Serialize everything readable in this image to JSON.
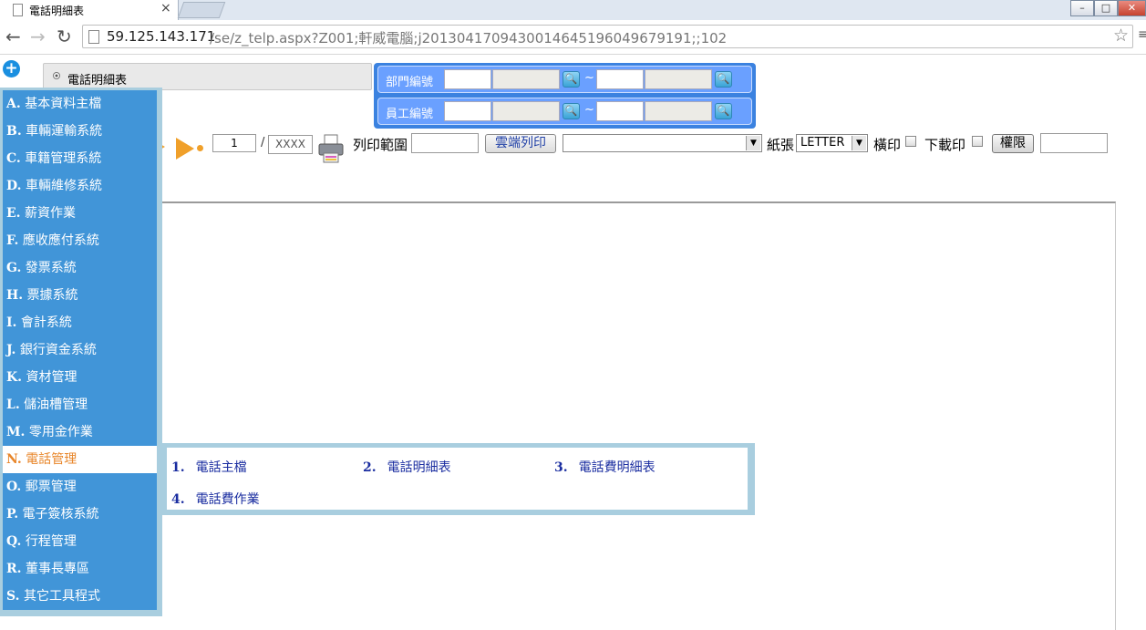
{
  "browser": {
    "tab_title": "電話明細表",
    "tab_close": "×",
    "win_min": "–",
    "win_max": "□",
    "win_close": "✕",
    "url_host": "59.125.143.171",
    "url_path": "/se/z_telp.aspx?Z001;軒威電腦;j20130417094300146451960496791​91;;102",
    "back": "←",
    "forward": "→",
    "reload": "↻",
    "star": "☆",
    "menu": "≡"
  },
  "page": {
    "plus": "+",
    "title": "電話明細表"
  },
  "filters": {
    "dept_label": "部門編號",
    "emp_label": "員工編號",
    "search_glyph": "🔍",
    "tilde": "~"
  },
  "toolbar": {
    "page_current": "1",
    "page_slash": "/",
    "page_total": "XXXX",
    "range_label": "列印範圍",
    "cloud_print": "雲端列印",
    "dropdown_glyph": "▼",
    "paper_label": "紙張",
    "paper_value": "LETTER",
    "landscape_label": "橫印",
    "download_label": "下載印",
    "permission": "權限"
  },
  "menu": {
    "items": [
      {
        "key": "A.",
        "label": "基本資料主檔"
      },
      {
        "key": "B.",
        "label": "車輛運輸系統"
      },
      {
        "key": "C.",
        "label": "車籍管理系統"
      },
      {
        "key": "D.",
        "label": "車輛維修系統"
      },
      {
        "key": "E.",
        "label": "薪資作業"
      },
      {
        "key": "F.",
        "label": "應收應付系統"
      },
      {
        "key": "G.",
        "label": "發票系統"
      },
      {
        "key": "H.",
        "label": "票據系統"
      },
      {
        "key": "I.",
        "label": "會計系統"
      },
      {
        "key": "J.",
        "label": "銀行資金系統"
      },
      {
        "key": "K.",
        "label": "資材管理"
      },
      {
        "key": "L.",
        "label": "儲油槽管理"
      },
      {
        "key": "M.",
        "label": "零用金作業"
      },
      {
        "key": "N.",
        "label": "電話管理"
      },
      {
        "key": "O.",
        "label": "郵票管理"
      },
      {
        "key": "P.",
        "label": "電子簽核系統"
      },
      {
        "key": "Q.",
        "label": "行程管理"
      },
      {
        "key": "R.",
        "label": "董事長專區"
      },
      {
        "key": "S.",
        "label": "其它工具程式"
      }
    ],
    "active_index": 13
  },
  "submenu": {
    "items": [
      {
        "num": "1.",
        "label": "電話主檔"
      },
      {
        "num": "2.",
        "label": "電話明細表"
      },
      {
        "num": "3.",
        "label": "電話費明細表"
      },
      {
        "num": "4.",
        "label": "電話費作業"
      }
    ]
  },
  "colors": {
    "menu_bg": "#4195d8",
    "menu_active_text": "#e8862a",
    "filter_bg": "#3b82e0",
    "arrow": "#f0a02a"
  }
}
